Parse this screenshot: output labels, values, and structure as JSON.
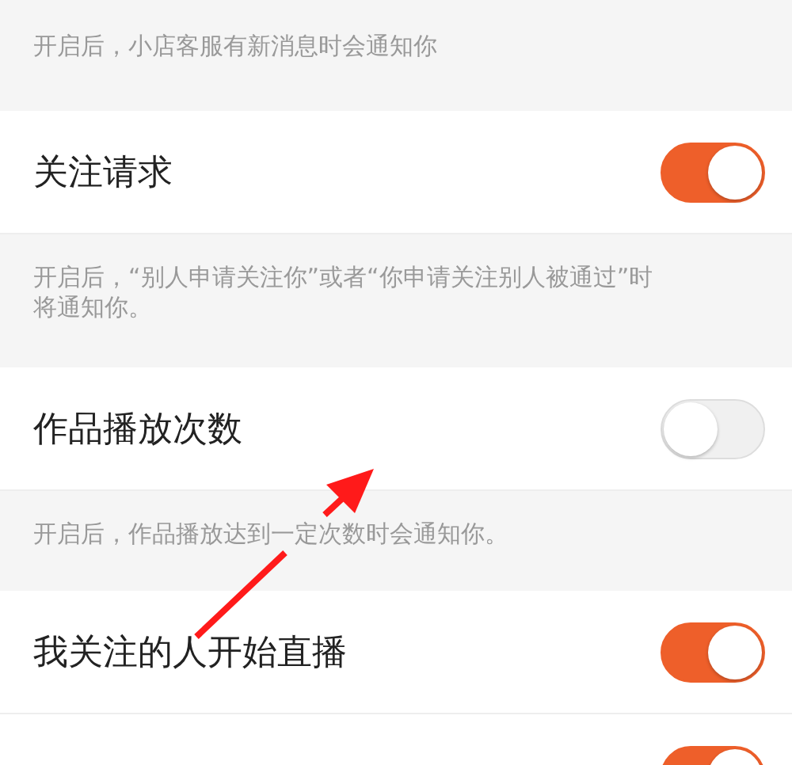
{
  "items": [
    {
      "kind": "description",
      "text": "开启后，小店客服有新消息时会通知你"
    },
    {
      "kind": "setting",
      "title": "关注请求",
      "on": true
    },
    {
      "kind": "description",
      "text": "开启后，“别人申请关注你”或者“你申请关注别人被通过”时将通知你。"
    },
    {
      "kind": "setting",
      "title": "作品播放次数",
      "on": false
    },
    {
      "kind": "description",
      "text": "开启后，作品播放达到一定次数时会通知你。"
    },
    {
      "kind": "setting",
      "title": "我关注的人开始直播",
      "on": true
    },
    {
      "kind": "setting",
      "on": true
    }
  ]
}
